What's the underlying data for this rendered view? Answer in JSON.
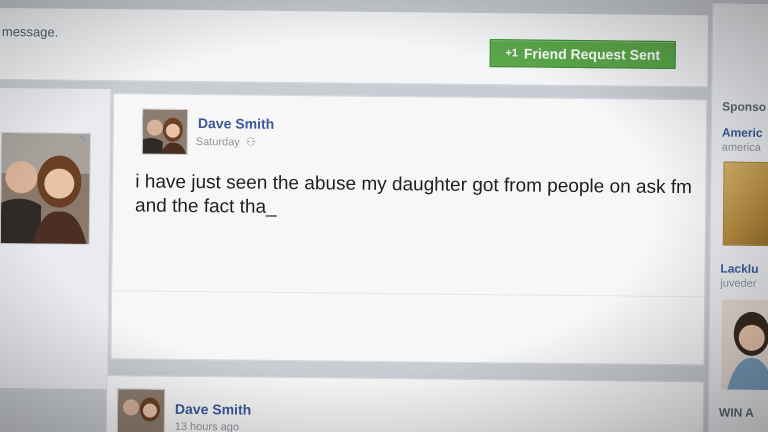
{
  "header": {
    "message_text": "message.",
    "friend_request_label": "Friend Request Sent",
    "friend_request_icon": "+1"
  },
  "post": {
    "author": "Dave Smith",
    "timestamp": "Saturday",
    "privacy_icon": "friends-icon",
    "text": "i have just seen the abuse my daughter got from people on ask fm and the fact tha_"
  },
  "post2": {
    "author": "Dave Smith",
    "timestamp": "13 hours ago"
  },
  "sidebar": {
    "heading": "Sponso",
    "ads": [
      {
        "title": "Americ",
        "url": "america"
      },
      {
        "title": "Lacklu",
        "url": "juveder"
      },
      {
        "title": "WIN A"
      }
    ]
  },
  "colors": {
    "friend_button": "#5ba84a",
    "link_blue": "#3b5998"
  }
}
